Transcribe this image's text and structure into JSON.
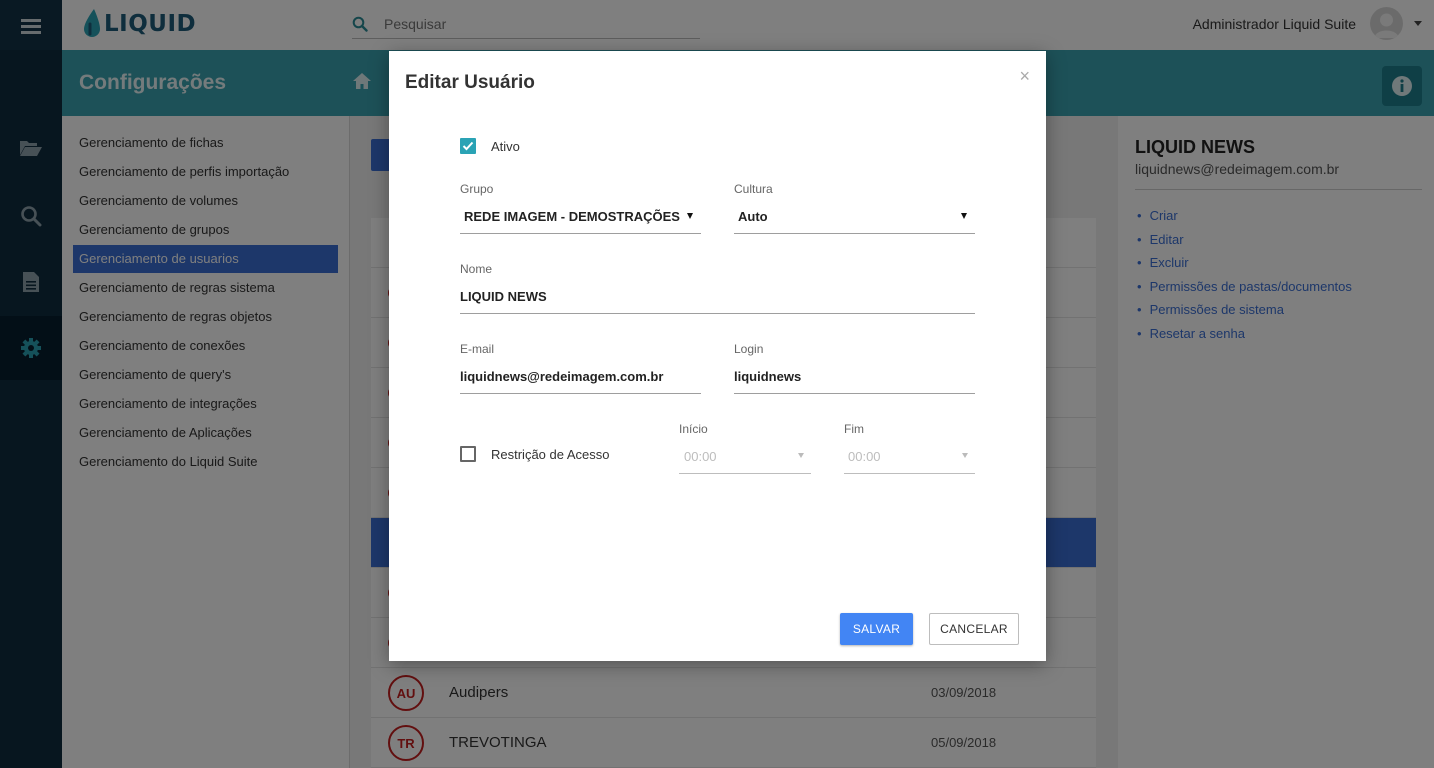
{
  "app": {
    "logo_text": "LIQUID"
  },
  "topbar": {
    "search_placeholder": "Pesquisar",
    "user_name": "Administrador Liquid Suite"
  },
  "header": {
    "title": "Configurações"
  },
  "settings_menu": [
    "Gerenciamento de fichas",
    "Gerenciamento de perfis importação",
    "Gerenciamento de volumes",
    "Gerenciamento de grupos",
    "Gerenciamento de usuarios",
    "Gerenciamento de regras sistema",
    "Gerenciamento de regras objetos",
    "Gerenciamento de conexões",
    "Gerenciamento de query's",
    "Gerenciamento de integrações",
    "Gerenciamento de Aplicações",
    "Gerenciamento do Liquid Suite"
  ],
  "user_list": {
    "rows": [
      {
        "initials": "AU",
        "name": "Audipers",
        "date": "03/09/2018"
      },
      {
        "initials": "TR",
        "name": "TREVOTINGA",
        "date": "05/09/2018"
      }
    ]
  },
  "detail": {
    "name": "LIQUID NEWS",
    "email": "liquidnews@redeimagem.com.br",
    "actions": [
      "Criar",
      "Editar",
      "Excluir",
      "Permissões de pastas/documentos",
      "Permissões de sistema",
      "Resetar a senha"
    ]
  },
  "modal": {
    "title": "Editar Usuário",
    "close": "×",
    "active_label": "Ativo",
    "active_checked": true,
    "group_label": "Grupo",
    "group_value": "REDE IMAGEM - DEMOSTRAÇÕES",
    "culture_label": "Cultura",
    "culture_value": "Auto",
    "name_label": "Nome",
    "name_value": "LIQUID NEWS",
    "email_label": "E-mail",
    "email_value": "liquidnews@redeimagem.com.br",
    "login_label": "Login",
    "login_value": "liquidnews",
    "restriction_label": "Restrição de Acesso",
    "restriction_checked": false,
    "start_label": "Início",
    "start_value": "00:00",
    "end_label": "Fim",
    "end_value": "00:00",
    "save_label": "SALVAR",
    "cancel_label": "CANCELAR"
  },
  "colors": {
    "teal_header": "#3aa3b0",
    "sidebar_dark": "#0f2c3f",
    "primary_blue": "#3b6fd4",
    "save_blue": "#4285f4",
    "checkbox_teal": "#2aa3b5",
    "badge_red": "#c51f1f"
  }
}
